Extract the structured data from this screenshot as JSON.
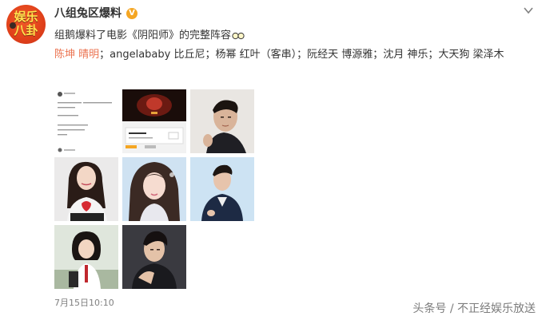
{
  "post": {
    "username": "八组兔区爆料",
    "verified_badge": "V",
    "text": "组鹅爆料了电影《阴阳师》的完整阵容",
    "emoji": "glasses-emoji",
    "cast_highlight": "陈坤 晴明",
    "cast_rest": "；angelababy 比丘尼；杨幂 红叶（客串）；阮经天 博源雅；沈月 神乐；大天狗 梁泽木",
    "timestamp": "7月15日10:10"
  },
  "avatar": {
    "line1": "娱乐",
    "line2": "八卦"
  },
  "images": [
    {
      "name": "screenshot-post"
    },
    {
      "name": "movie-poster"
    },
    {
      "name": "actor-portrait-1"
    },
    {
      "name": "actress-portrait-1"
    },
    {
      "name": "actress-portrait-2"
    },
    {
      "name": "actor-portrait-2"
    },
    {
      "name": "actress-portrait-3"
    },
    {
      "name": "actor-portrait-3"
    }
  ],
  "watermark": "头条号 / 不正经娱乐放送",
  "colors": {
    "link": "#eb7350",
    "badge": "#f5a623",
    "text": "#333333",
    "meta": "#808080"
  }
}
